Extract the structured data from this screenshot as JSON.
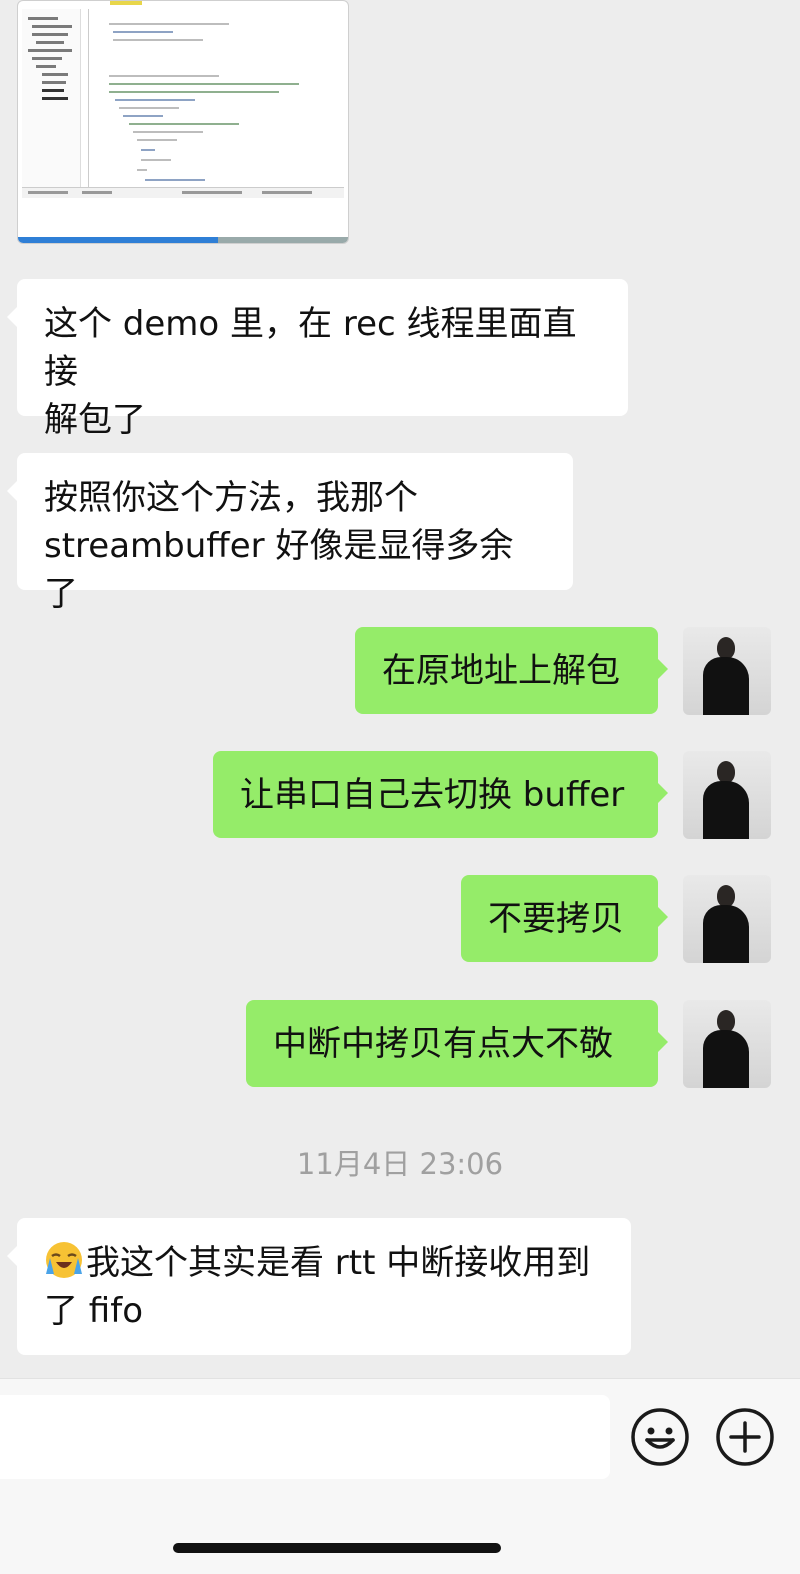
{
  "messages": [
    {
      "side": "left",
      "text_lines": [
        "这个 demo 里，在 rec 线程里面直接",
        "解包了"
      ]
    },
    {
      "side": "left",
      "text_lines": [
        "按照你这个方法，我那个",
        "streambuffer 好像是显得多余了"
      ]
    },
    {
      "side": "right",
      "text": "在原地址上解包"
    },
    {
      "side": "right",
      "text": "让串口自己去切换 buffer"
    },
    {
      "side": "right",
      "text": "不要拷贝"
    },
    {
      "side": "right",
      "text": "中断中拷贝有点大不敬"
    },
    {
      "side": "left",
      "emoji": "loudly-crying-face",
      "text_lines": [
        "我这个其实是看 rtt 中断接收用到",
        "了 fifo"
      ]
    }
  ],
  "timestamp": "11月4日 23:06",
  "colors": {
    "background": "#ededed",
    "sent_bubble": "#95ec69",
    "received_bubble": "#ffffff",
    "timestamp": "#a0a0a0"
  },
  "icons": {
    "emoji_button": "smiley-face-icon",
    "add_button": "plus-circle-icon"
  }
}
